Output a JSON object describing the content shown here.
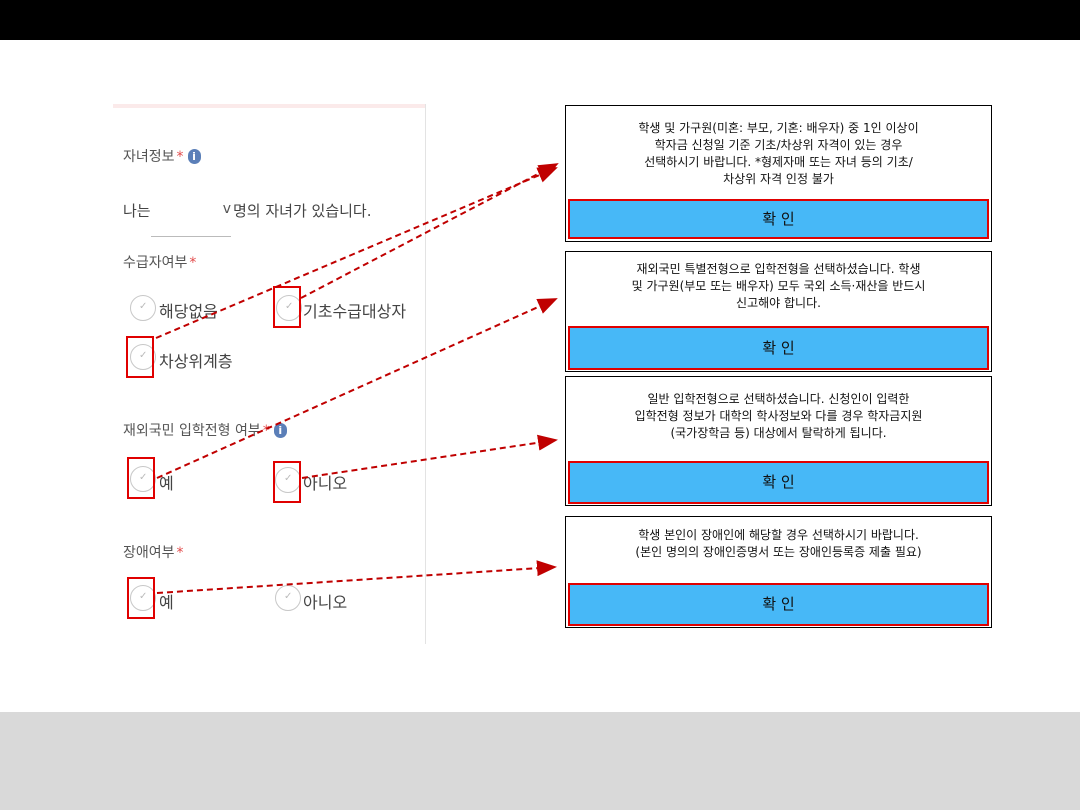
{
  "form": {
    "children_info": {
      "label": "자녀정보",
      "required": "*",
      "info_icon": "info-icon",
      "prefix": "나는",
      "select_icon": "chevron-down-icon",
      "select_glyph": "v",
      "suffix": "명의 자녀가 있습니다."
    },
    "welfare_status": {
      "label": "수급자여부",
      "required": "*",
      "options": [
        "해당없음",
        "기초수급대상자",
        "차상위계층"
      ]
    },
    "overseas_admission": {
      "label": "재외국민 입학전형 여부",
      "required": "*",
      "info_icon": "info-icon",
      "options": [
        "예",
        "아니오"
      ]
    },
    "disability": {
      "label": "장애여부",
      "required": "*",
      "options": [
        "예",
        "아니오"
      ]
    }
  },
  "dialogs": [
    {
      "message": "학생 및 가구원(미혼: 부모, 기혼: 배우자) 중 1인 이상이\n학자금 신청일 기준 기초/차상위 자격이 있는 경우\n선택하시기 바랍니다. *형제자매 또는 자녀 등의 기초/\n차상위 자격 인정 불가",
      "confirm": "확 인"
    },
    {
      "message": "재외국민 특별전형으로 입학전형을 선택하셨습니다. 학생\n및 가구원(부모 또는 배우자) 모두 국외 소득·재산을 반드시\n신고해야 합니다.",
      "confirm": "확 인"
    },
    {
      "message": "일반 입학전형으로 선택하셨습니다. 신청인이 입력한\n입학전형 정보가 대학의 학사정보와 다를 경우 학자금지원\n(국가장학금 등) 대상에서 탈락하게 됩니다.",
      "confirm": "확 인"
    },
    {
      "message": "학생 본인이 장애인에 해당할 경우 선택하시기 바랍니다.\n(본인 명의의 장애인증명서 또는 장애인등록증 제출 필요)",
      "confirm": "확 인"
    }
  ],
  "icons": {
    "radio_check": "check-icon",
    "check_glyph": "✓"
  },
  "colors": {
    "confirm_button": "#47b8f7",
    "highlight": "#e00000",
    "arrow": "#c00000",
    "required_star": "#e24a4a",
    "top_bar": "#000000",
    "bottom_bar": "#d9d9d9"
  }
}
